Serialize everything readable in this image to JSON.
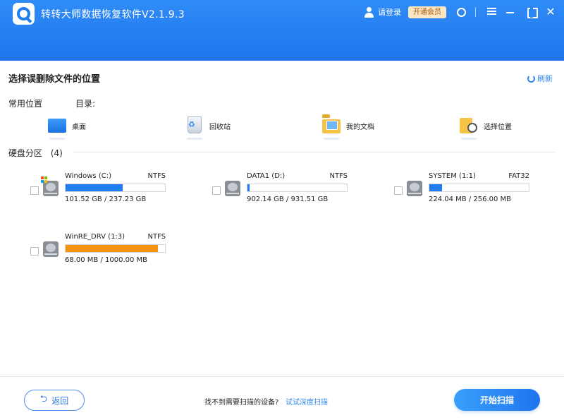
{
  "app": {
    "title": "转转大师数据恢复软件V2.1.9.3",
    "login_label": "请登录",
    "vip_label": "开通会员"
  },
  "header": {
    "title": "选择误删除文件的位置",
    "refresh_label": "刷新"
  },
  "common": {
    "label": "常用位置",
    "dir_label": "目录:"
  },
  "quick_locations": [
    {
      "label": "桌面",
      "icon": "desktop-icon"
    },
    {
      "label": "回收站",
      "icon": "recycle-bin-icon"
    },
    {
      "label": "我的文档",
      "icon": "documents-folder-icon"
    },
    {
      "label": "选择位置",
      "icon": "choose-location-icon"
    }
  ],
  "disks_section": {
    "label": "硬盘分区",
    "count": "(4)"
  },
  "disks": [
    {
      "name": "Windows  (C:)",
      "fs": "NTFS",
      "size": "101.52 GB / 237.23 GB",
      "used_fraction": 0.572,
      "bar_color": "#1f7cf2",
      "windows": true
    },
    {
      "name": "DATA1  (D:)",
      "fs": "NTFS",
      "size": "902.14 GB / 931.51 GB",
      "used_fraction": 0.02,
      "bar_color": "#1f7cf2",
      "windows": false
    },
    {
      "name": "SYSTEM  (1:1)",
      "fs": "FAT32",
      "size": "224.04 MB / 256.00 MB",
      "used_fraction": 0.125,
      "bar_color": "#1f7cf2",
      "windows": false
    },
    {
      "name": "WinRE_DRV  (1:3)",
      "fs": "NTFS",
      "size": "68.00 MB / 1000.00 MB",
      "used_fraction": 0.93,
      "bar_color": "#f7940f",
      "windows": false
    }
  ],
  "footer": {
    "back_label": "返回",
    "hint": "找不到需要扫描的设备?",
    "deep_scan_label": "试试深度扫描",
    "start_label": "开始扫描"
  },
  "colors": {
    "accent": "#1f74ee",
    "warning_bar": "#f7940f"
  }
}
